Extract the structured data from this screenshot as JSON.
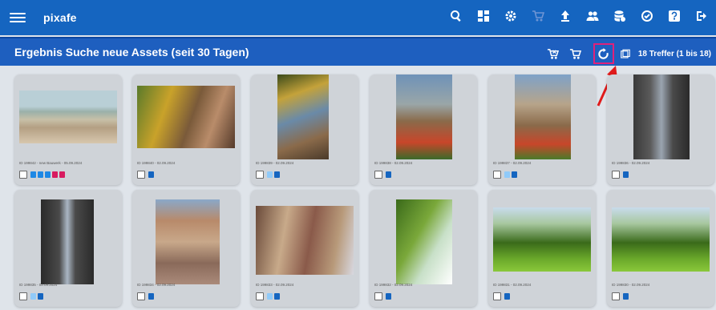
{
  "app": {
    "logo": "pixafe"
  },
  "toolbar_icons": [
    "search-icon",
    "dashboard-icon",
    "settings-icon",
    "cart-icon",
    "upload-icon",
    "users-icon",
    "database-icon",
    "block-icon",
    "help-icon",
    "logout-icon"
  ],
  "header": {
    "title": "Ergebnis Suche neue Assets (seit 30 Tagen)",
    "hits": "18 Treffer (1 bis 18)"
  },
  "cards": [
    {
      "caption": "ID 199842 - new Bauwerk - 05.09.2024",
      "badges": [
        "#1e88e5",
        "#1e88e5",
        "#1e88e5",
        "#d81b60",
        "#d81b60"
      ]
    },
    {
      "caption": "ID 199840 - 02.09.2024",
      "badges": [
        "#1565c0"
      ]
    },
    {
      "caption": "ID 199839 - 02.09.2024",
      "badges": [
        "#90caf9",
        "#1565c0"
      ]
    },
    {
      "caption": "ID 199838 - 02.09.2024",
      "badges": [
        "#1565c0"
      ]
    },
    {
      "caption": "ID 199837 - 02.09.2024",
      "badges": [
        "#90caf9",
        "#1565c0"
      ]
    },
    {
      "caption": "ID 199836 - 02.09.2024",
      "badges": [
        "#1565c0"
      ]
    },
    {
      "caption": "ID 199835 - 02.09.2024",
      "badges": [
        "#90caf9",
        "#1565c0"
      ]
    },
    {
      "caption": "ID 199834 - 02.09.2024",
      "badges": [
        "#1565c0"
      ]
    },
    {
      "caption": "ID 199833 - 02.09.2024",
      "badges": [
        "#90caf9",
        "#1565c0"
      ]
    },
    {
      "caption": "ID 199832 - 02.09.2024",
      "badges": [
        "#1565c0"
      ]
    },
    {
      "caption": "ID 199831 - 02.09.2024",
      "badges": [
        "#1565c0"
      ]
    },
    {
      "caption": "ID 199830 - 02.09.2024",
      "badges": [
        "#1565c0"
      ]
    }
  ]
}
